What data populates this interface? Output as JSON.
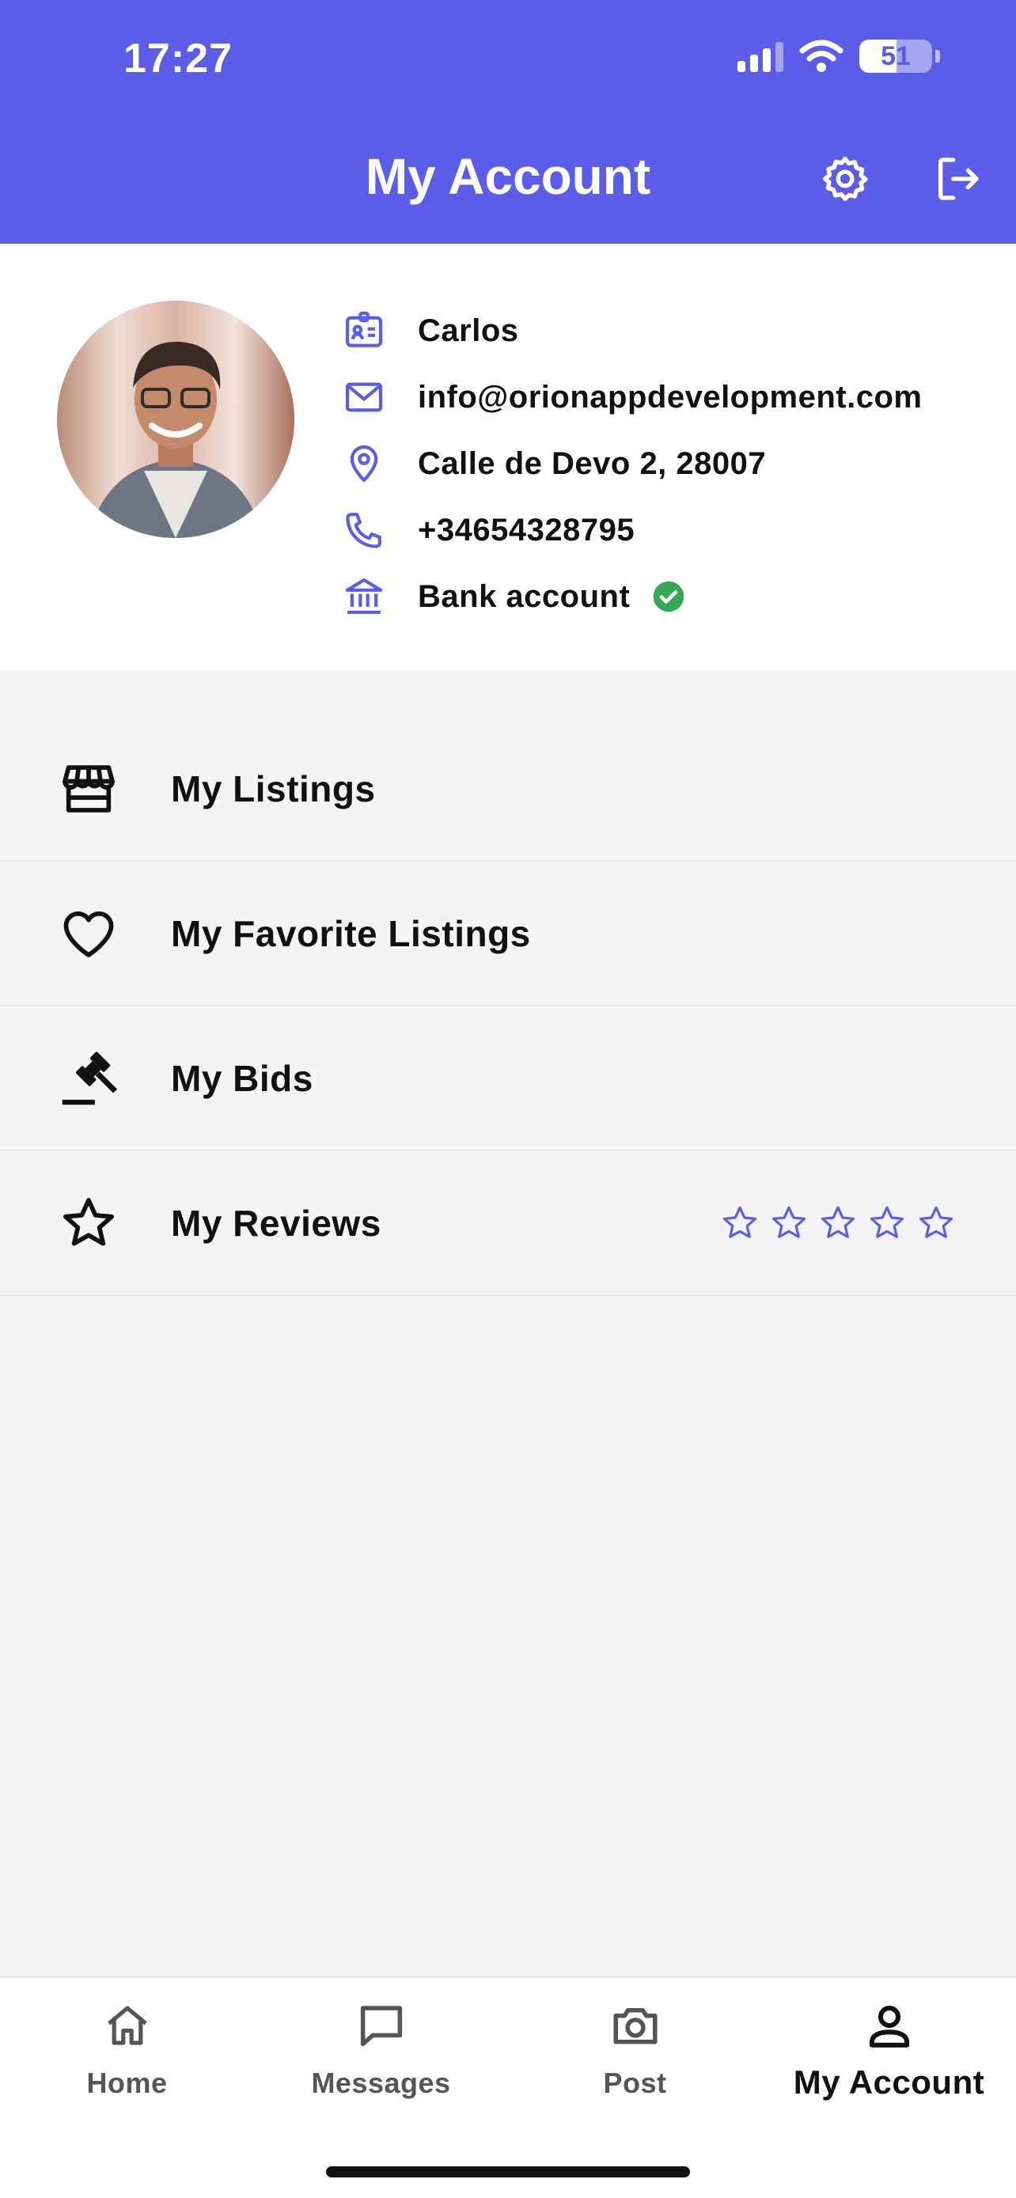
{
  "status_bar": {
    "time": "17:27",
    "battery": "51",
    "battery_level": 0.51
  },
  "header": {
    "title": "My Account",
    "settings_icon": "gear-icon",
    "logout_icon": "logout-icon"
  },
  "colors": {
    "accent": "#5b5ce8",
    "success": "#34a853",
    "background": "#f4f4f6"
  },
  "profile": {
    "avatar_icon": "user-photo",
    "name": "Carlos",
    "email": "info@orionappdevelopment.com",
    "address": "Calle de Devo 2, 28007",
    "phone": "+34654328795",
    "bank": "Bank account",
    "bank_verified": true
  },
  "menu": {
    "items": [
      {
        "label": "My Listings",
        "icon": "storefront-icon"
      },
      {
        "label": "My Favorite Listings",
        "icon": "heart-icon"
      },
      {
        "label": "My Bids",
        "icon": "gavel-icon"
      },
      {
        "label": "My Reviews",
        "icon": "star-icon",
        "rating": 0,
        "rating_max": 5
      }
    ]
  },
  "tabbar": {
    "tabs": [
      {
        "label": "Home",
        "icon": "home-icon"
      },
      {
        "label": "Messages",
        "icon": "chat-icon"
      },
      {
        "label": "Post",
        "icon": "camera-icon"
      },
      {
        "label": "My Account",
        "icon": "user-icon",
        "active": true
      }
    ]
  }
}
